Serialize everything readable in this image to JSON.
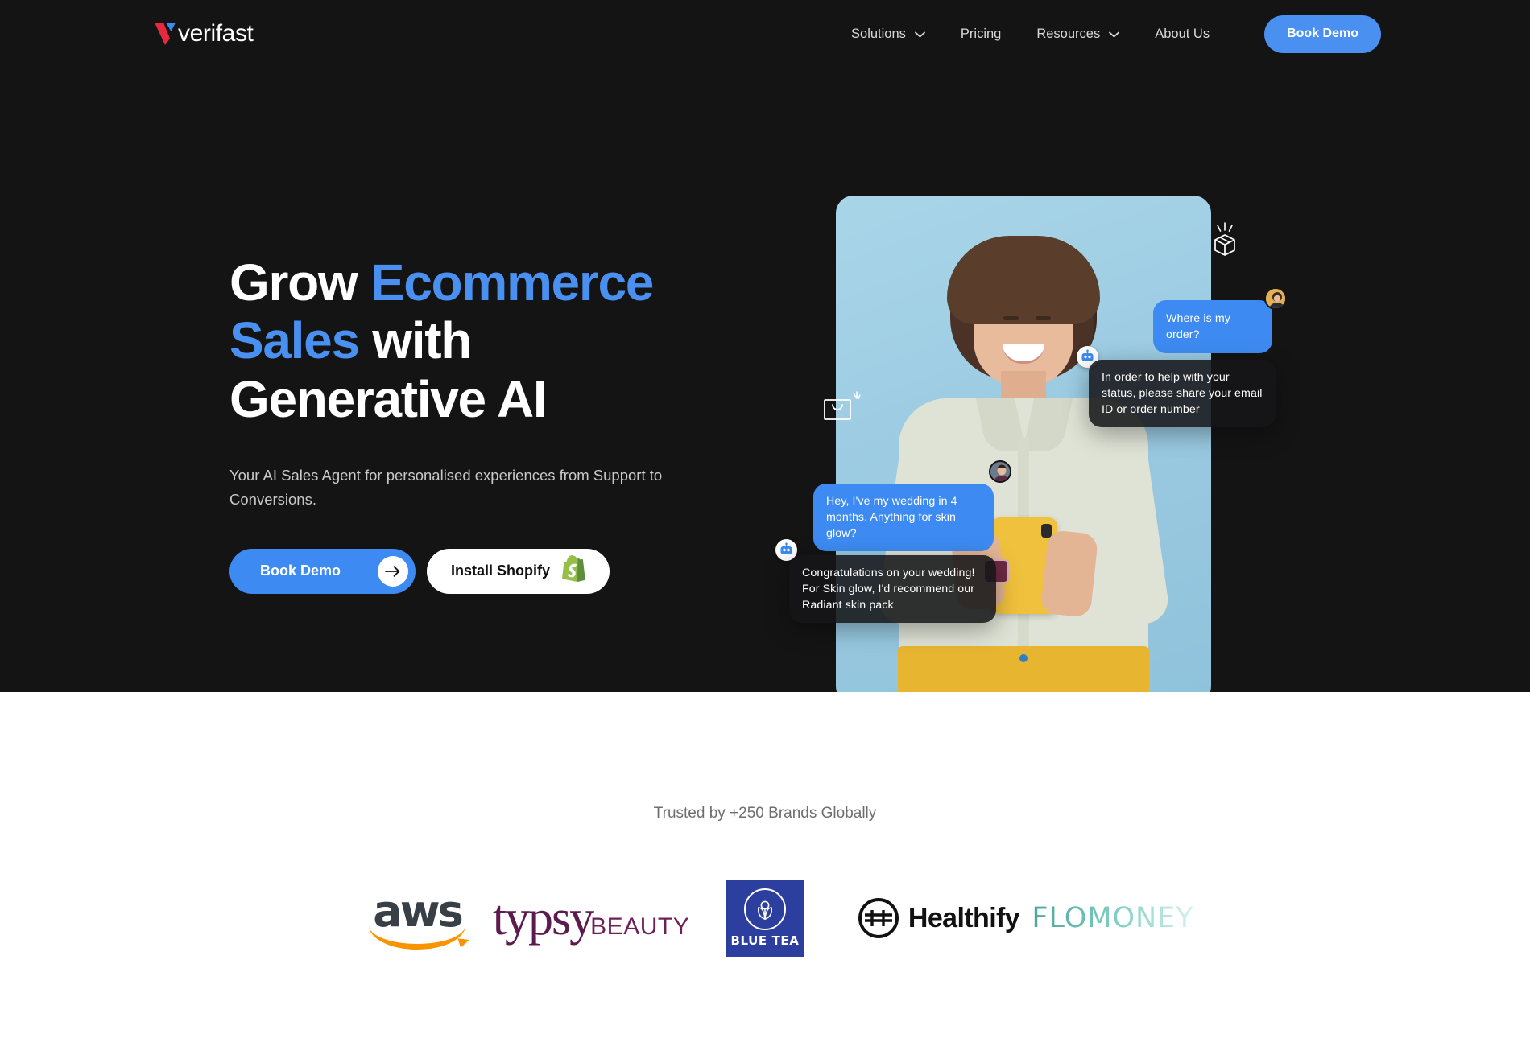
{
  "brand": {
    "name": "verifast",
    "logo_colors": {
      "red": "#e8283c",
      "blue": "#3d8bf2"
    }
  },
  "header": {
    "nav": [
      {
        "label": "Solutions",
        "has_dropdown": true
      },
      {
        "label": "Pricing",
        "has_dropdown": false
      },
      {
        "label": "Resources",
        "has_dropdown": true
      },
      {
        "label": "About Us",
        "has_dropdown": false
      }
    ],
    "cta": {
      "label": "Book Demo",
      "color": "#4a90f0"
    }
  },
  "hero": {
    "title": {
      "line1_plain": "Grow ",
      "line1_accent": "Ecommerce",
      "line2_accent": "Sales",
      "line2_plain": " with",
      "line3_plain": "Generative AI"
    },
    "accent_color": "#4a90f0",
    "subtitle": "Your AI Sales Agent for personalised experiences from Support to Conversions.",
    "primary_cta": {
      "label": "Book Demo",
      "icon": "arrow-right-icon"
    },
    "secondary_cta": {
      "label": "Install Shopify",
      "icon": "shopify-icon"
    },
    "floating_icons": [
      "package-box-icon",
      "shopping-bag-icon"
    ],
    "chat": [
      {
        "id": "order",
        "role": "user",
        "text": "Where is my order?"
      },
      {
        "id": "status",
        "role": "bot",
        "text": "In order to help with your status, please share your email ID or order number"
      },
      {
        "id": "wedding",
        "role": "user",
        "text": "Hey, I've my wedding in 4 months. Anything for skin glow?"
      },
      {
        "id": "reco",
        "role": "bot",
        "text": "Congratulations on your wedding! For Skin glow, I'd recommend our Radiant skin pack"
      }
    ],
    "bubble_colors": {
      "user": "#3d8bf2",
      "bot": "#161618"
    }
  },
  "trusted": {
    "title": "Trusted by +250 Brands Globally",
    "logos": [
      {
        "name": "aws",
        "label": "aws"
      },
      {
        "name": "typsy-beauty",
        "label_a": "typsy",
        "label_b": "BEAUTY"
      },
      {
        "name": "blue-tea",
        "label": "BLUE TEA"
      },
      {
        "name": "healthify",
        "label": "Healthify"
      },
      {
        "name": "flomoney",
        "label": "FLOMONEY"
      }
    ]
  }
}
